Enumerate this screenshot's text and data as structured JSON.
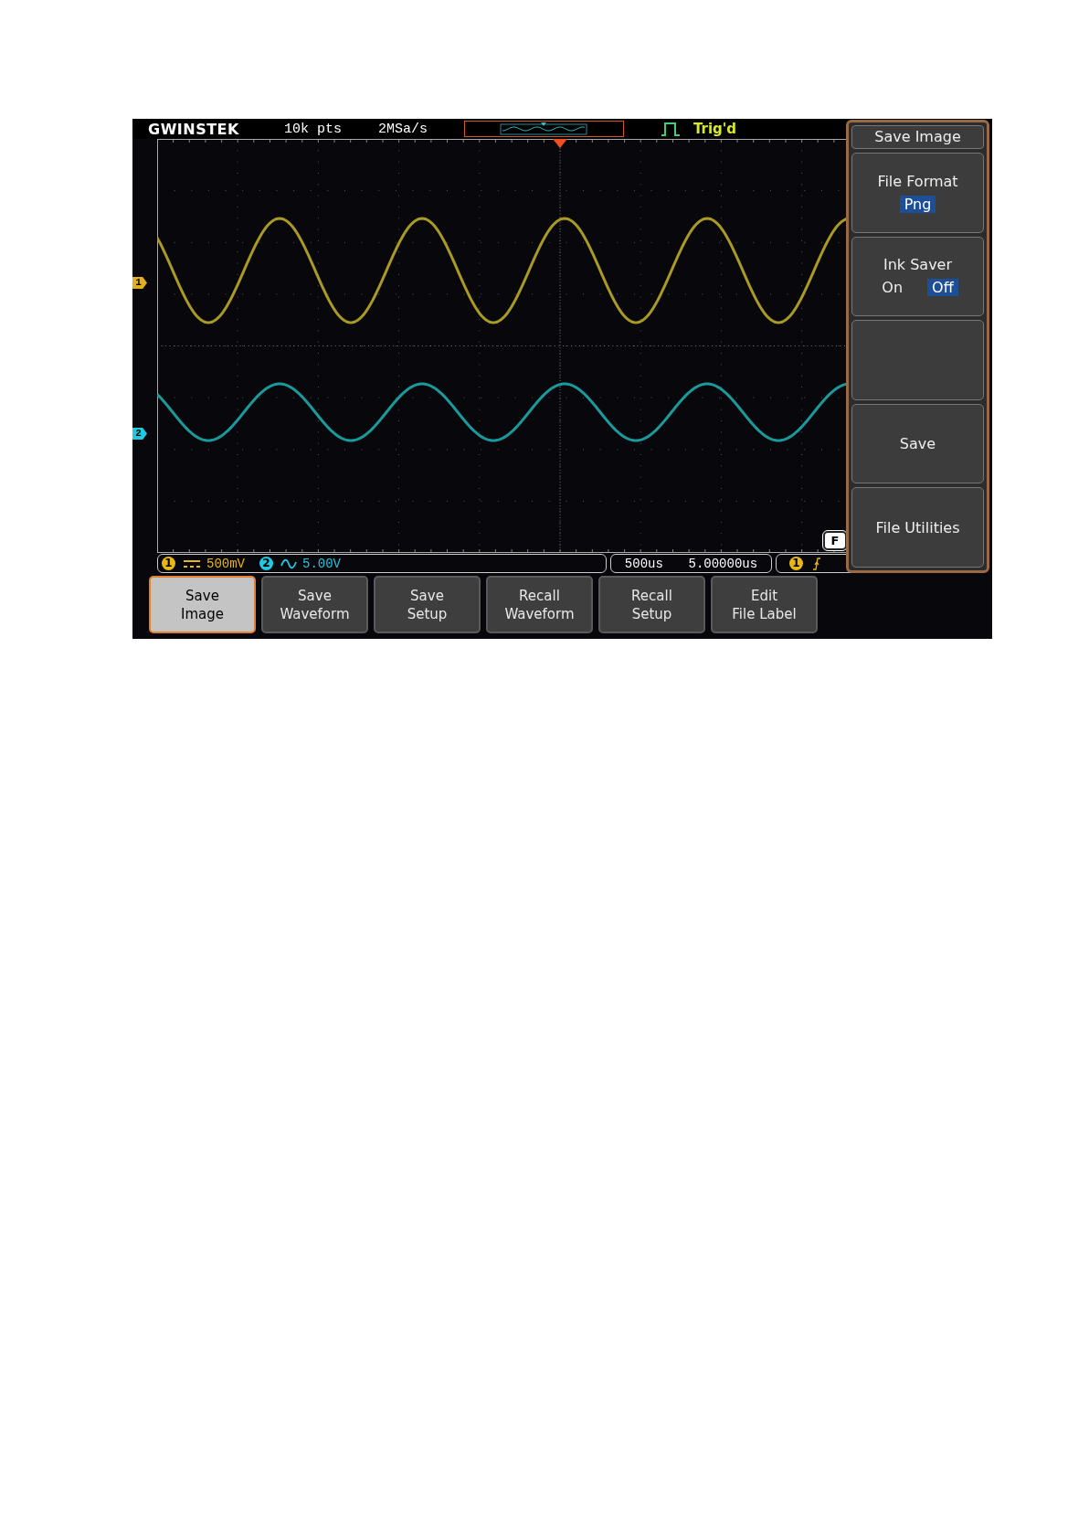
{
  "header": {
    "logo": "GWINSTEK",
    "record_length": "10k pts",
    "sample_rate": "2MSa/s",
    "trigger_status": "Trig'd"
  },
  "channel_markers": [
    {
      "label": "1",
      "color": "#e0b020"
    },
    {
      "label": "2",
      "color": "#20c8e0"
    }
  ],
  "reference_marker": "F",
  "status_bar": {
    "channels": [
      {
        "number": "1",
        "kind": "dc",
        "scale": "500mV",
        "color": "#e8b818"
      },
      {
        "number": "2",
        "kind": "ac",
        "scale": "5.00V",
        "color": "#20c8e0"
      }
    ],
    "timebase": {
      "scale": "500us",
      "position": "5.00000us"
    },
    "trigger": {
      "source": "1",
      "color": "#e8b818"
    }
  },
  "side_menu": {
    "title": "Save Image",
    "items": [
      {
        "kind": "option",
        "label": "File Format",
        "options": [
          {
            "label": "Png",
            "selected": true
          }
        ]
      },
      {
        "kind": "option",
        "label": "Ink Saver",
        "options": [
          {
            "label": "On",
            "selected": false
          },
          {
            "label": "Off",
            "selected": true
          }
        ]
      },
      {
        "kind": "blank"
      },
      {
        "kind": "action",
        "label": "Save"
      },
      {
        "kind": "action",
        "label": "File Utilities"
      }
    ]
  },
  "soft_keys": [
    {
      "lines": [
        "Save",
        "Image"
      ],
      "selected": true
    },
    {
      "lines": [
        "Save",
        "Waveform"
      ],
      "selected": false
    },
    {
      "lines": [
        "Save",
        "Setup"
      ],
      "selected": false
    },
    {
      "lines": [
        "Recall",
        "Waveform"
      ],
      "selected": false
    },
    {
      "lines": [
        "Recall",
        "Setup"
      ],
      "selected": false
    },
    {
      "lines": [
        "Edit",
        "File Label"
      ],
      "selected": false
    }
  ]
}
